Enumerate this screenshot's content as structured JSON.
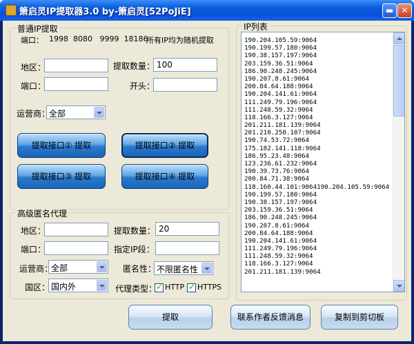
{
  "window": {
    "title": "箫启灵IP提取器3.0   by-箫启灵[52PoJiE]",
    "min_glyph": "▬",
    "close_glyph": "✕"
  },
  "normal": {
    "group_title": "普通IP提取",
    "ports_label": "端口：",
    "ports_value": "1998  8080   9999  18186",
    "random_note": "所有IP均为随机提取",
    "region_label": "地区：",
    "region_value": "",
    "qty_label": "提取数量：",
    "qty_value": "100",
    "port_label": "端口：",
    "port_value": "",
    "prefix_label": "开头：",
    "prefix_value": "",
    "isp_label": "运营商：",
    "isp_value": "全部",
    "buttons": [
      "提取接口① 提取",
      "提取接口② 提取",
      "提取接口③ 提取",
      "提取接口④ 提取"
    ]
  },
  "advanced": {
    "group_title": "高级匿名代理",
    "region_label": "地区：",
    "region_value": "",
    "qty_label": "提取数量：",
    "qty_value": "20",
    "port_label": "端口：",
    "port_value": "",
    "ip_seg_label": "指定IP段：",
    "ip_seg_value": "",
    "isp_label": "运营商：",
    "isp_value": "全部",
    "anon_label": "匿名性：",
    "anon_value": "不限匿名性",
    "area_label": "国区：",
    "area_value": "国内外",
    "proxy_type_label": "代理类型：",
    "http_label": "HTTP",
    "https_label": "HTTPS",
    "extract_button": "提取"
  },
  "iplist": {
    "group_title": "IP列表",
    "lines": [
      "190.204.105.59:9064",
      "190.199.57.180:9064",
      "190.38.157.197:9064",
      "203.159.36.51:9064",
      "186.90.248.245:9064",
      "190.207.8.61:9064",
      "200.84.64.188:9064",
      "190.204.141.61:9064",
      "111.249.79.196:9064",
      "111.248.59.32:9064",
      "118.166.3.127:9064",
      "201.211.181.139:9064",
      "201.210.250.107:9064",
      "190.74.53.72:9064",
      "175.182.141.118:9064",
      "186.95.23.48:9064",
      "123.236.61.232:9064",
      "190.39.73.76:9064",
      "200.84.71.38:9064",
      "118.160.44.101:9064190.204.105.59:9064",
      "190.199.57.180:9064",
      "190.38.157.197:9064",
      "203.159.36.51:9064",
      "186.90.248.245:9064",
      "190.207.8.61:9064",
      "200.84.64.188:9064",
      "190.204.141.61:9064",
      "111.249.79.196:9064",
      "111.248.59.32:9064",
      "118.166.3.127:9064",
      "201.211.181.139:9064"
    ]
  },
  "footer": {
    "contact_button": "联系作者反馈消息",
    "copy_button": "复制到剪切板"
  }
}
